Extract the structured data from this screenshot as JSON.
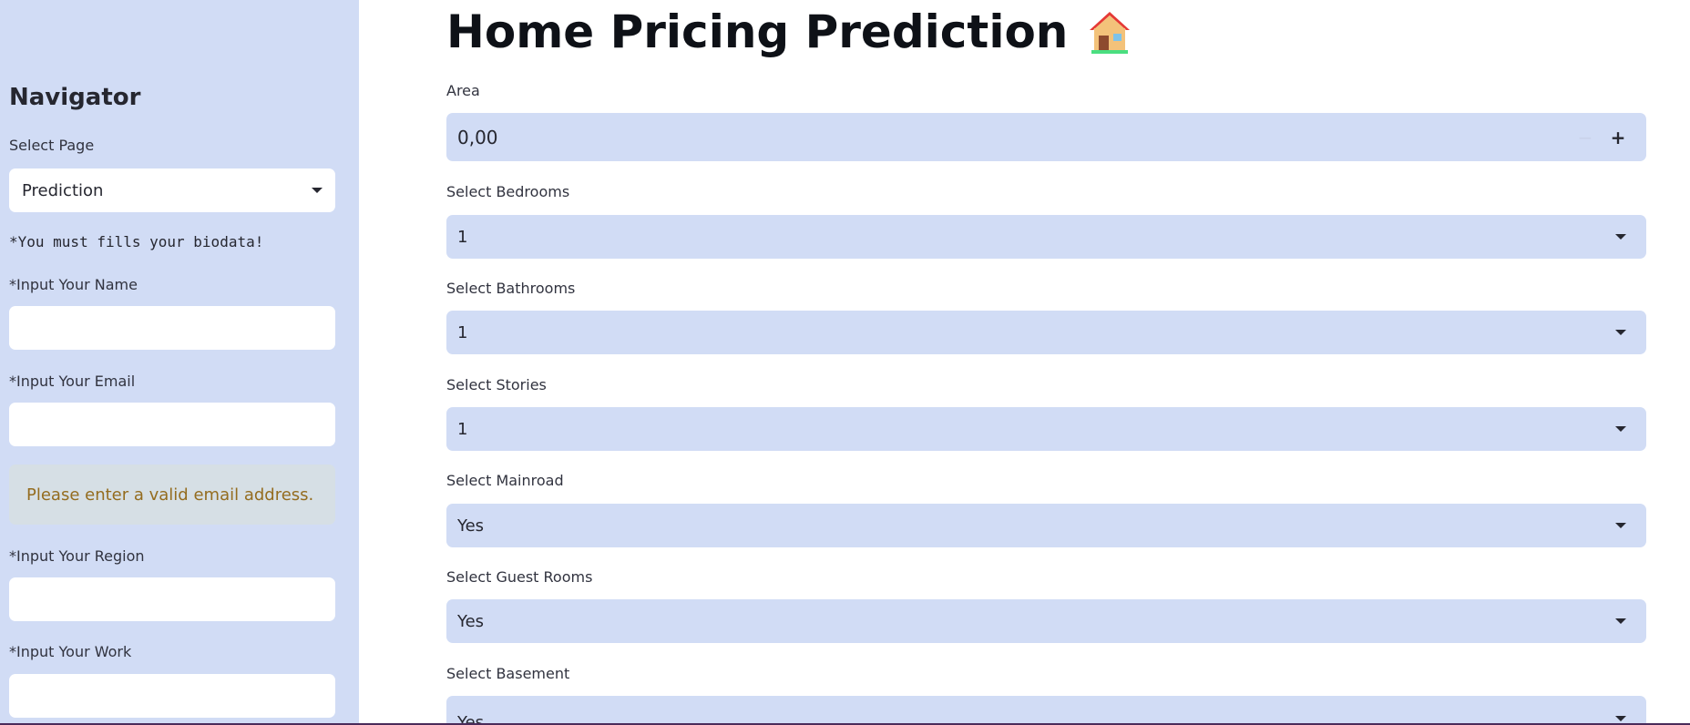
{
  "sidebar": {
    "title": "Navigator",
    "select_page_label": "Select Page",
    "select_page_value": "Prediction",
    "note": "*You must fills your biodata!",
    "name_label": "*Input Your Name",
    "name_value": "",
    "email_label": "*Input Your Email",
    "email_value": "",
    "warning": "Please enter a valid email address.",
    "region_label": "*Input Your Region",
    "region_value": "",
    "work_label": "*Input Your Work",
    "work_value": ""
  },
  "main": {
    "title": "Home Pricing Prediction",
    "title_icon": "house-icon",
    "area": {
      "label": "Area",
      "value": "0,00"
    },
    "bedrooms": {
      "label": "Select Bedrooms",
      "value": "1"
    },
    "bathrooms": {
      "label": "Select Bathrooms",
      "value": "1"
    },
    "stories": {
      "label": "Select Stories",
      "value": "1"
    },
    "mainroad": {
      "label": "Select Mainroad",
      "value": "Yes"
    },
    "guestrooms": {
      "label": "Select Guest Rooms",
      "value": "Yes"
    },
    "basement": {
      "label": "Select Basement",
      "value": "Yes"
    }
  },
  "colors": {
    "sidebar_bg": "#d1dcf5",
    "field_bg": "#d1dcf5",
    "warning_text": "#946c1f",
    "warning_bg": "#d6dfe5"
  }
}
